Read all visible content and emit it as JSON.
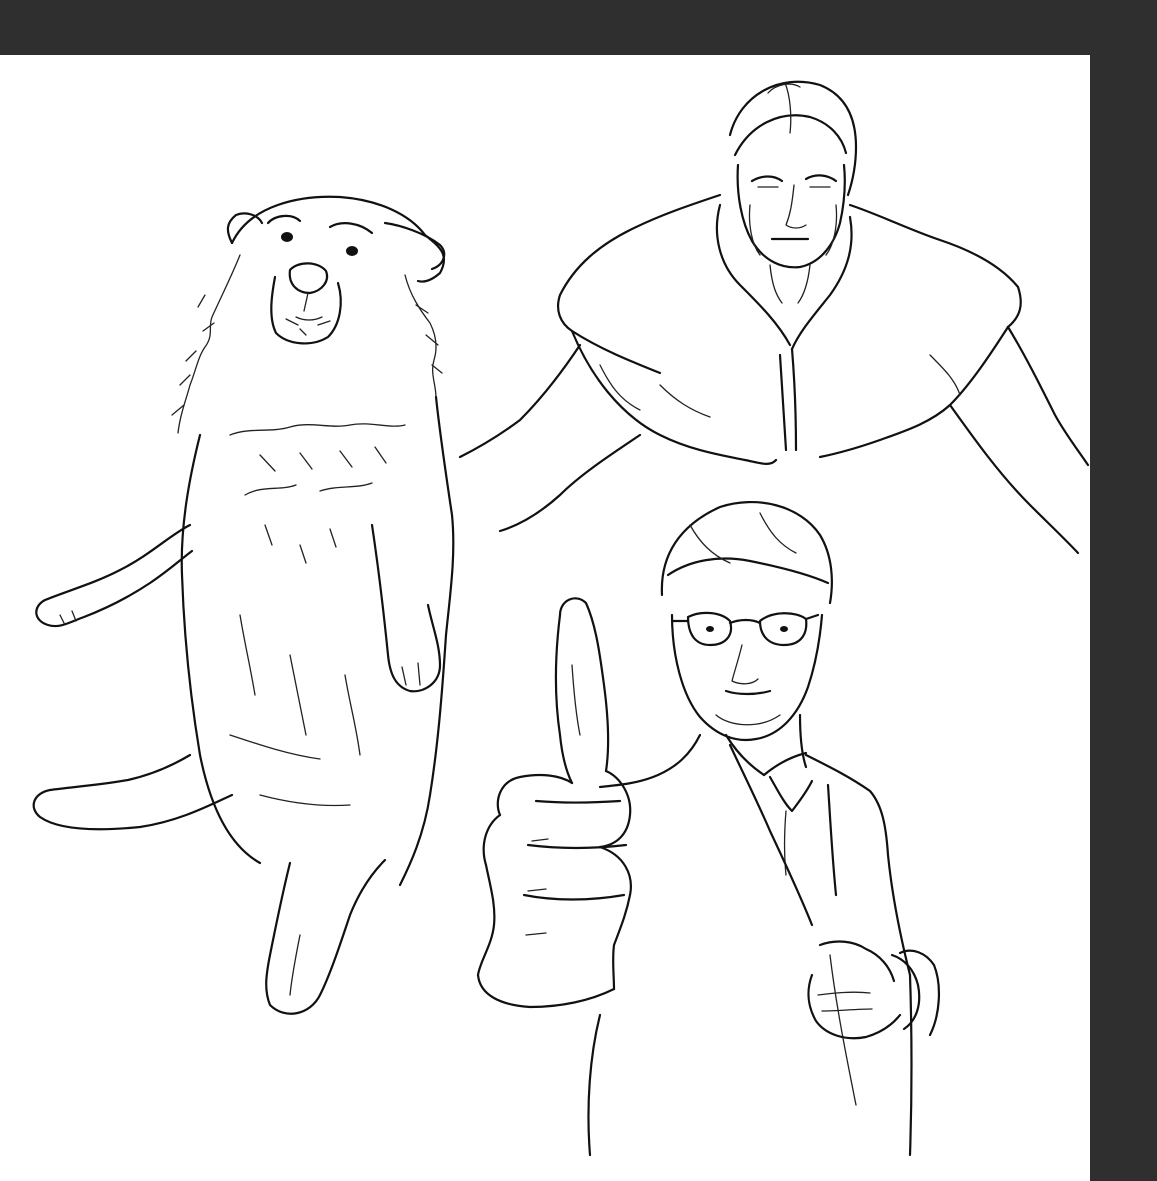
{
  "app": {
    "accent_dark": "#2f2f2f",
    "canvas_color": "#ffffff",
    "ink_color": "#111111"
  },
  "canvas": {
    "subjects": [
      "dog-sketch",
      "caped-man-sketch",
      "thumbs-up-man-sketch"
    ]
  }
}
